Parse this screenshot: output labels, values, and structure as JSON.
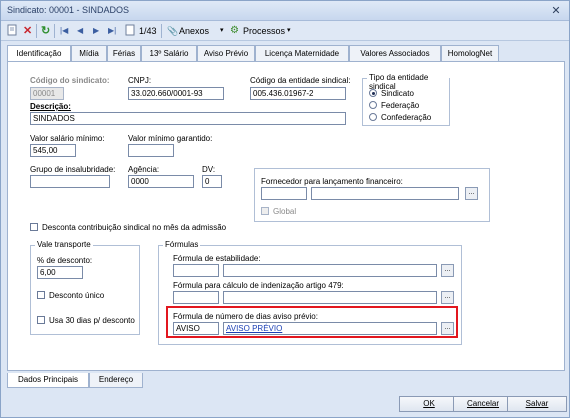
{
  "window": {
    "title": "Sindicato: 00001 - SINDADOS",
    "close_glyph": "✕"
  },
  "toolbar": {
    "record_position": "1/43",
    "attachments_label": "Anexos",
    "processes_label": "Processos"
  },
  "tabs": [
    {
      "label": "Identificação",
      "active": true
    },
    {
      "label": "Mídia"
    },
    {
      "label": "Férias"
    },
    {
      "label": "13º Salário"
    },
    {
      "label": "Aviso Prévio"
    },
    {
      "label": "Licença Maternidade"
    },
    {
      "label": "Valores Associados"
    },
    {
      "label": "HomologNet"
    }
  ],
  "form": {
    "union_code": {
      "label": "Código do sindicato:",
      "value": "00001"
    },
    "cnpj": {
      "label": "CNPJ:",
      "value": "33.020.660/0001-93"
    },
    "entity_code": {
      "label": "Código da entidade sindical:",
      "value": "005.436.01967-2"
    },
    "entity_type": {
      "title": "Tipo da entidade sindical",
      "options": [
        "Sindicato",
        "Federação",
        "Confederação"
      ],
      "selected": "Sindicato"
    },
    "description": {
      "label": "Descrição:",
      "value": "SINDADOS"
    },
    "min_salary": {
      "label": "Valor salário mínimo:",
      "value": "545,00"
    },
    "min_guaranteed": {
      "label": "Valor mínimo garantido:",
      "value": ""
    },
    "unhealthy_group": {
      "label": "Grupo de insalubridade:",
      "value": ""
    },
    "agency": {
      "label": "Agência:",
      "value": "0000"
    },
    "dv": {
      "label": "DV:",
      "value": "0"
    },
    "supplier": {
      "label": "Fornecedor para lançamento financeiro:",
      "code": "",
      "name": "",
      "global_label": "Global"
    },
    "discount_admission": {
      "label": "Desconta contribuição sindical no mês da admissão"
    },
    "transport": {
      "title": "Vale transporte",
      "discount_pct": {
        "label": "% de desconto:",
        "value": "6,00"
      },
      "single_discount_label": "Desconto único",
      "use_30_days_label": "Usa 30 dias p/ desconto"
    },
    "formulas": {
      "title": "Fórmulas",
      "stability": {
        "label": "Fórmula de estabilidade:",
        "code": "",
        "name": ""
      },
      "art479": {
        "label": "Fórmula para cálculo de indenização artigo 479:",
        "code": "",
        "name": ""
      },
      "notice_days": {
        "label": "Fórmula de número de dias aviso prévio:",
        "code": "AVISO",
        "name": "AVISO PRÉVIO"
      }
    }
  },
  "bottom_tabs": [
    {
      "label": "Dados Principais",
      "active": true
    },
    {
      "label": "Endereço"
    }
  ],
  "buttons": {
    "ok": "OK",
    "cancel": "Cancelar",
    "save": "Salvar"
  },
  "lookup_glyph": "...",
  "colors": {
    "highlight": "#e2171f",
    "link": "#1a3fb5"
  }
}
